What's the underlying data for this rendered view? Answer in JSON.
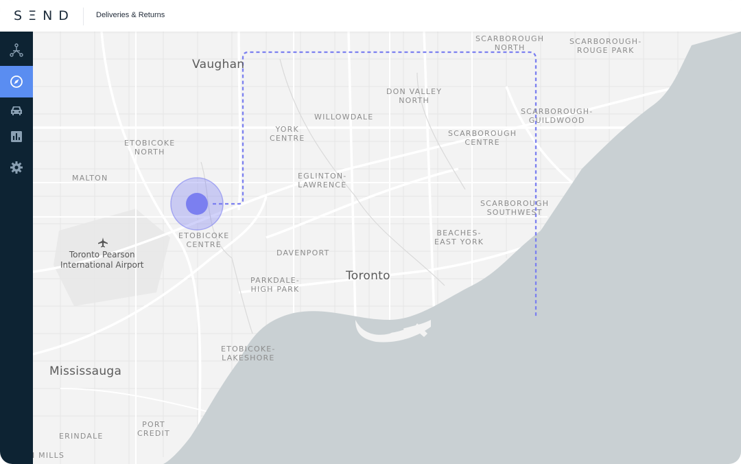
{
  "header": {
    "logo_text": "SΞND",
    "page_title": "Deliveries & Returns"
  },
  "sidebar": {
    "items": [
      {
        "name": "routes",
        "icon": "route-nodes-icon",
        "active": false
      },
      {
        "name": "explore",
        "icon": "compass-icon",
        "active": true
      },
      {
        "name": "vehicles",
        "icon": "car-icon",
        "active": false
      },
      {
        "name": "analytics",
        "icon": "bar-chart-icon",
        "active": false
      },
      {
        "name": "settings",
        "icon": "gear-icon",
        "active": false
      }
    ]
  },
  "map": {
    "cities": {
      "vaughan": "Vaughan",
      "toronto": "Toronto",
      "mississauga": "Mississauga"
    },
    "areas": {
      "scarborough_north": "SCARBOROUGH\nNORTH",
      "scarborough_rouge_park": "SCARBOROUGH-\nROUGE PARK",
      "don_valley_north": "DON VALLEY\nNORTH",
      "willowdale": "WILLOWDALE",
      "scarborough_guildwood": "SCARBOROUGH-\nGUILDWOOD",
      "york_centre": "YORK\nCENTRE",
      "scarborough_centre": "SCARBOROUGH\nCENTRE",
      "etobicoke_north": "ETOBICOKE\nNORTH",
      "eglinton_lawrence": "EGLINTON-\nLAWRENCE",
      "malton": "MALTON",
      "scarborough_southwest": "SCARBOROUGH\nSOUTHWEST",
      "etobicoke_centre": "ETOBICOKE\nCENTRE",
      "beaches_east_york": "BEACHES-\nEAST YORK",
      "davenport": "DAVENPORT",
      "parkdale_high_park": "PARKDALE-\nHIGH PARK",
      "etobicoke_lakeshore": "ETOBICOKE-\nLAKESHORE",
      "port_credit": "PORT\nCREDIT",
      "erindale": "ERINDALE",
      "mills": "N MILLS"
    },
    "poi": {
      "airport": "Toronto Pearson\nInternational Airport"
    },
    "colors": {
      "land": "#f3f3f3",
      "water": "#c9d0d3",
      "route": "#7b7ff0",
      "marker": "#7b7ff0",
      "sidebar": "#0d2333",
      "active_nav": "#5a8df1"
    }
  }
}
